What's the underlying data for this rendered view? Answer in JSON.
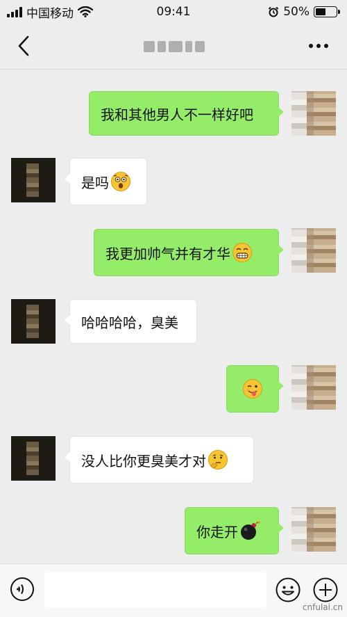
{
  "status_bar": {
    "carrier": "中国移动",
    "time": "09:41",
    "battery_percent": "50%",
    "battery_level": 0.5
  },
  "nav": {
    "back_icon": "chevron-left-icon",
    "more_icon": "ellipsis-icon"
  },
  "messages": [
    {
      "from": "me",
      "text": "我和其他男人不一样好吧",
      "emoji": ""
    },
    {
      "from": "other",
      "text": "是吗",
      "emoji": "astonished-face"
    },
    {
      "from": "me",
      "text": "我更加帅气并有才华",
      "emoji": "grinning-teeth-face"
    },
    {
      "from": "other",
      "text": "哈哈哈哈，臭美",
      "emoji": ""
    },
    {
      "from": "me",
      "text": "",
      "emoji": "tongue-wink-face"
    },
    {
      "from": "other",
      "text": "没人比你更臭美才对",
      "emoji": "thinking-face"
    },
    {
      "from": "me",
      "text": "你走开",
      "emoji": "bomb"
    }
  ],
  "input_bar": {
    "voice_icon": "voice-icon",
    "emoji_icon": "smile-icon",
    "plus_icon": "plus-icon",
    "placeholder": ""
  },
  "watermark": "cnfulai.cn",
  "colors": {
    "background": "#ededed",
    "my_bubble": "#95ec69",
    "other_bubble": "#ffffff",
    "emoji_yellow": "#f7c531"
  }
}
